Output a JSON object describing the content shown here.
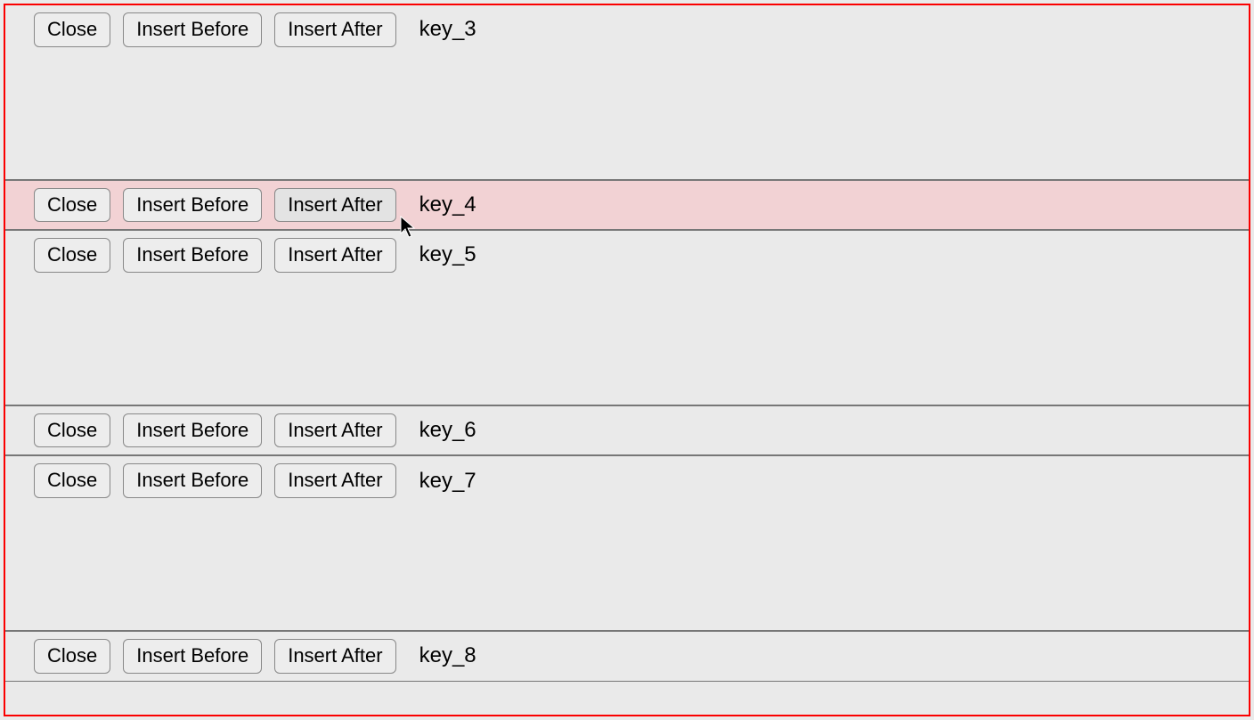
{
  "buttons": {
    "close": "Close",
    "insert_before": "Insert Before",
    "insert_after": "Insert After"
  },
  "rows": [
    {
      "key": "key_3",
      "tall": true,
      "highlight": false
    },
    {
      "key": "key_4",
      "tall": false,
      "highlight": true
    },
    {
      "key": "key_5",
      "tall": true,
      "highlight": false
    },
    {
      "key": "key_6",
      "tall": false,
      "highlight": false
    },
    {
      "key": "key_7",
      "tall": true,
      "highlight": false
    },
    {
      "key": "key_8",
      "tall": false,
      "highlight": false
    }
  ],
  "colors": {
    "outer_border": "#fb0000",
    "highlight_bg": "#f2d2d4",
    "bg": "#eaeaea"
  }
}
